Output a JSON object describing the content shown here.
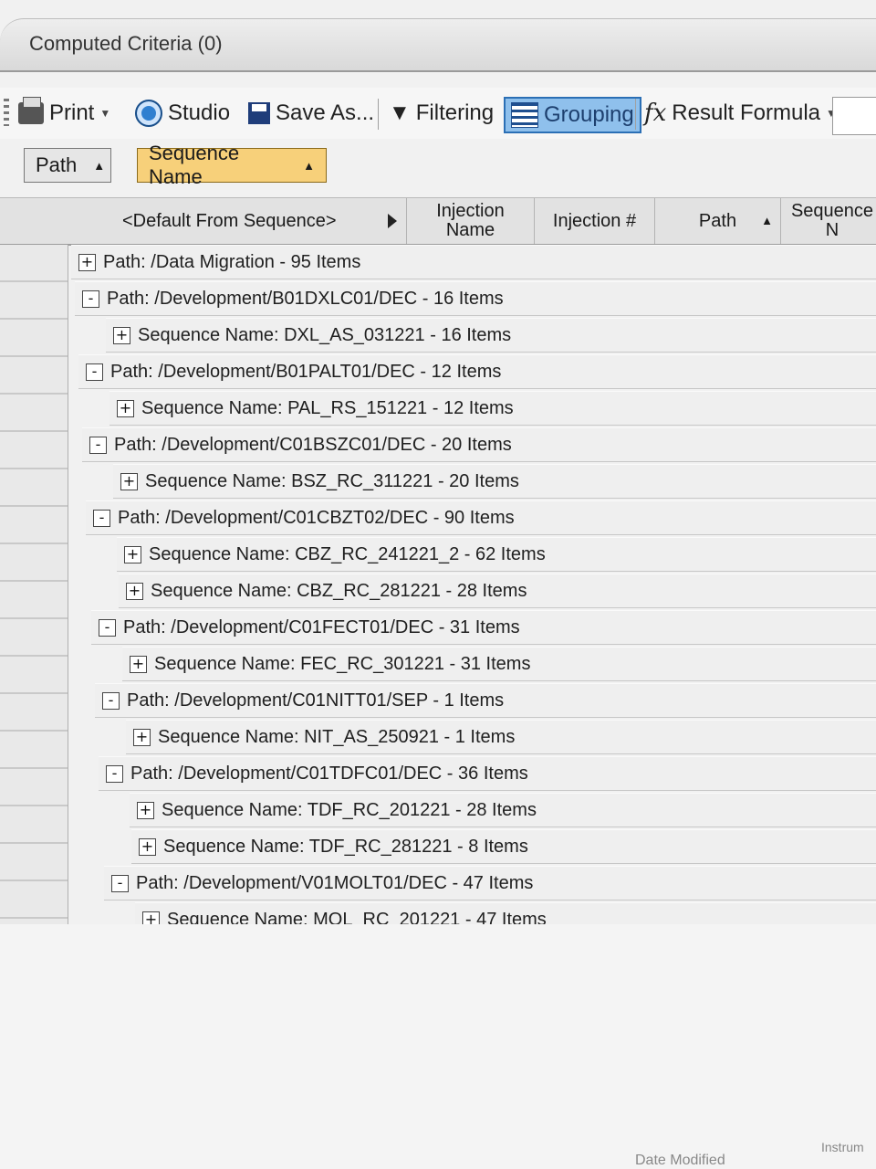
{
  "criteria": {
    "title": "Computed Criteria (0)"
  },
  "toolbar": {
    "print_label": "Print",
    "studio_label": "Studio",
    "saveas_label": "Save As...",
    "filtering_label": "Filtering",
    "grouping_label": "Grouping",
    "formula_label": "Result Formula",
    "icons": [
      "printer-icon",
      "studio-icon",
      "save-icon",
      "filter-icon",
      "grouping-icon",
      "fx-icon"
    ],
    "grouping_active_color": "#8fc0ec"
  },
  "group_panel": {
    "chips": [
      {
        "label": "Path"
      },
      {
        "label": "Sequence Name",
        "color": "#f7d07a"
      }
    ]
  },
  "columns": {
    "default_from_sequence": "<Default From Sequence>",
    "injection_name": "Injection Name",
    "injection_no": "Injection #",
    "path": "Path",
    "sequence": "Sequence N"
  },
  "rows": [
    {
      "toggle": "+",
      "text": "Path: /Data Migration - 95 Items"
    },
    {
      "toggle": "-",
      "text": "Path: /Development/B01DXLC01/DEC - 16 Items"
    },
    {
      "toggle": "+",
      "text": "Sequence Name: DXL_AS_031221 - 16 Items"
    },
    {
      "toggle": "-",
      "text": "Path: /Development/B01PALT01/DEC - 12 Items"
    },
    {
      "toggle": "+",
      "text": "Sequence Name: PAL_RS_151221 - 12 Items"
    },
    {
      "toggle": "-",
      "text": "Path: /Development/C01BSZC01/DEC - 20 Items"
    },
    {
      "toggle": "+",
      "text": "Sequence Name: BSZ_RC_311221 - 20 Items"
    },
    {
      "toggle": "-",
      "text": "Path: /Development/C01CBZT02/DEC - 90 Items"
    },
    {
      "toggle": "+",
      "text": "Sequence Name: CBZ_RC_241221_2 - 62 Items"
    },
    {
      "toggle": "+",
      "text": "Sequence Name: CBZ_RC_281221 - 28 Items"
    },
    {
      "toggle": "-",
      "text": "Path: /Development/C01FECT01/DEC - 31 Items"
    },
    {
      "toggle": "+",
      "text": "Sequence Name: FEC_RC_301221 - 31 Items"
    },
    {
      "toggle": "-",
      "text": "Path: /Development/C01NITT01/SEP - 1 Items"
    },
    {
      "toggle": "+",
      "text": "Sequence Name: NIT_AS_250921 - 1 Items"
    },
    {
      "toggle": "-",
      "text": "Path: /Development/C01TDFC01/DEC - 36 Items"
    },
    {
      "toggle": "+",
      "text": "Sequence Name: TDF_RC_201221 - 28 Items"
    },
    {
      "toggle": "+",
      "text": "Sequence Name: TDF_RC_281221 - 8 Items"
    },
    {
      "toggle": "-",
      "text": "Path: /Development/V01MOLT01/DEC - 47 Items"
    },
    {
      "toggle": "+",
      "text": "Sequence Name: MOL_RC_201221 - 47 Items"
    }
  ],
  "footer": {
    "left": "Date Modified",
    "right": "Instrum"
  }
}
